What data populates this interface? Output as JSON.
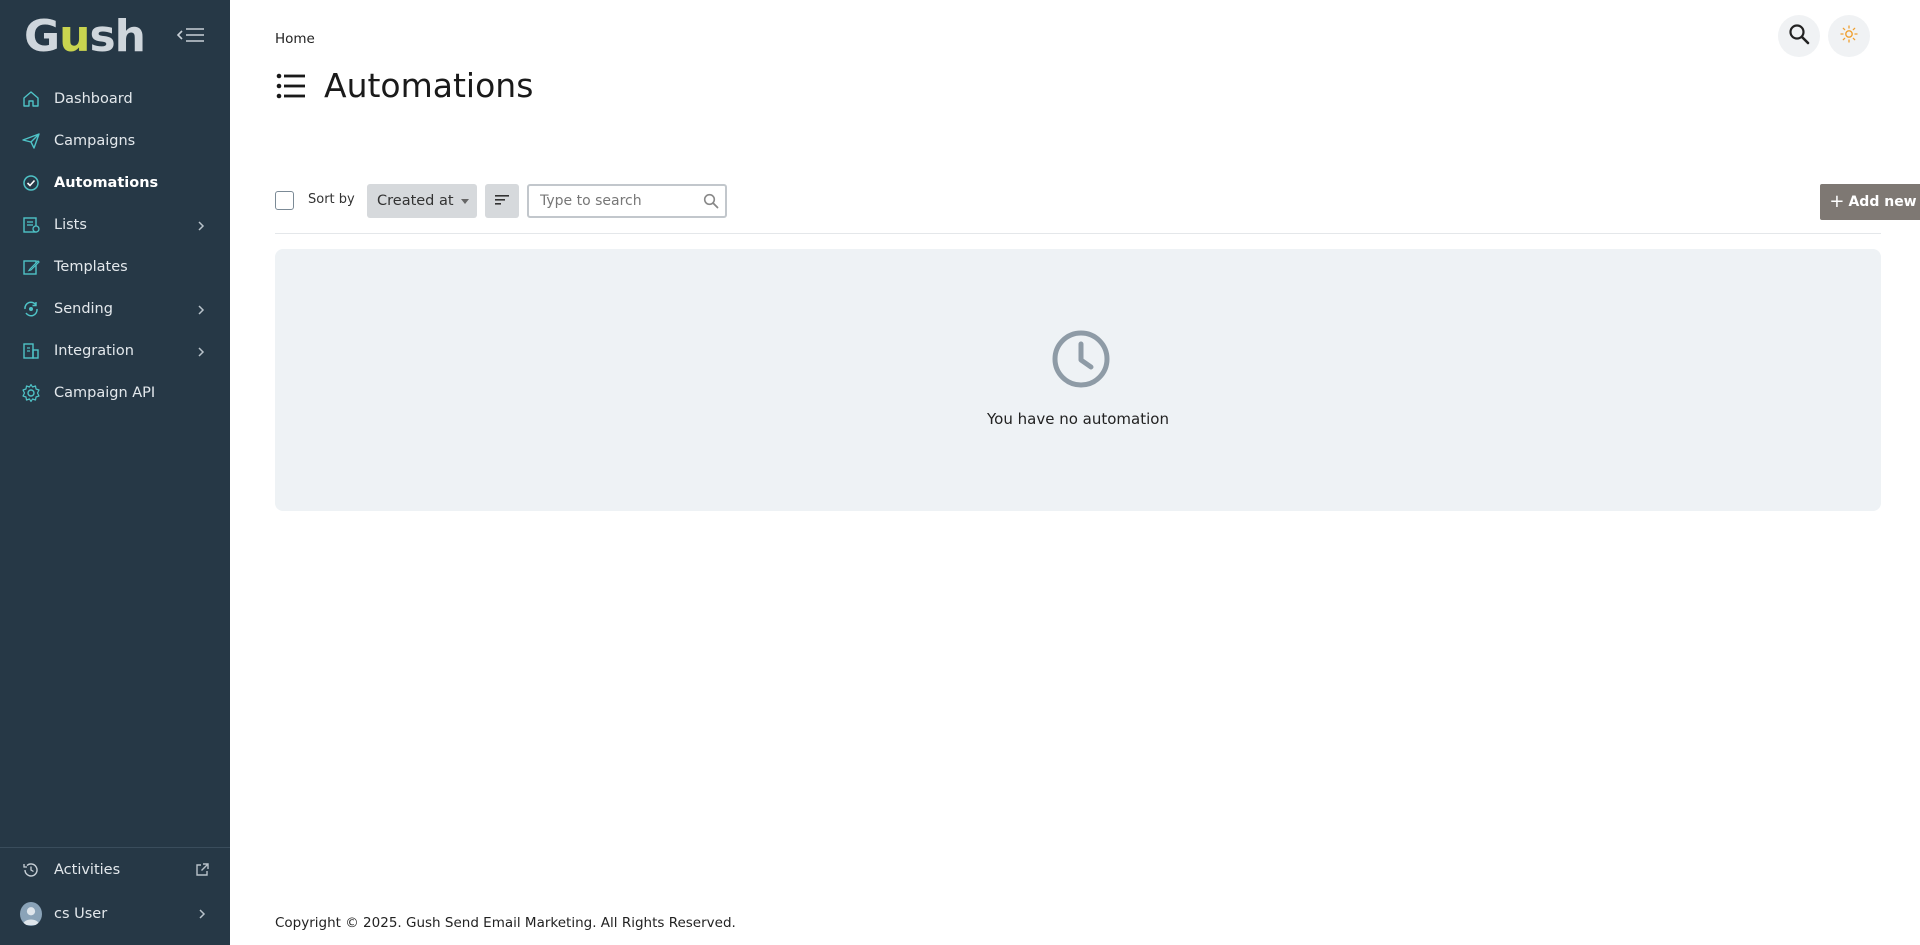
{
  "sidebar": {
    "logo": {
      "prefix": "G",
      "middle": "u",
      "suffix": "sh"
    },
    "items": [
      {
        "label": "Dashboard",
        "icon": "home-icon",
        "active": false,
        "has_submenu": false
      },
      {
        "label": "Campaigns",
        "icon": "paper-plane-icon",
        "active": false,
        "has_submenu": false
      },
      {
        "label": "Automations",
        "icon": "shield-check-icon",
        "active": true,
        "has_submenu": false
      },
      {
        "label": "Lists",
        "icon": "list-icon",
        "active": false,
        "has_submenu": true
      },
      {
        "label": "Templates",
        "icon": "edit-icon",
        "active": false,
        "has_submenu": false
      },
      {
        "label": "Sending",
        "icon": "sync-icon",
        "active": false,
        "has_submenu": true
      },
      {
        "label": "Integration",
        "icon": "building-icon",
        "active": false,
        "has_submenu": true
      },
      {
        "label": "Campaign API",
        "icon": "gear-icon",
        "active": false,
        "has_submenu": false
      }
    ],
    "bottom": {
      "activities_label": "Activities",
      "user_label": "cs User"
    }
  },
  "header": {
    "breadcrumb": "Home",
    "title": "Automations"
  },
  "toolbar": {
    "sort_by_label": "Sort by",
    "sort_selected": "Created at",
    "search_placeholder": "Type to search",
    "add_new_label": "Add new"
  },
  "empty_state": {
    "message": "You have no automation"
  },
  "footer": {
    "copyright": "Copyright © 2025. Gush Send Email Marketing. All Rights Reserved."
  },
  "colors": {
    "sidebar_bg": "#263846",
    "accent_green": "#c9d44f",
    "icon_teal": "#4fc3c7",
    "add_button": "#7e7873",
    "theme_sun": "#f0a030"
  }
}
